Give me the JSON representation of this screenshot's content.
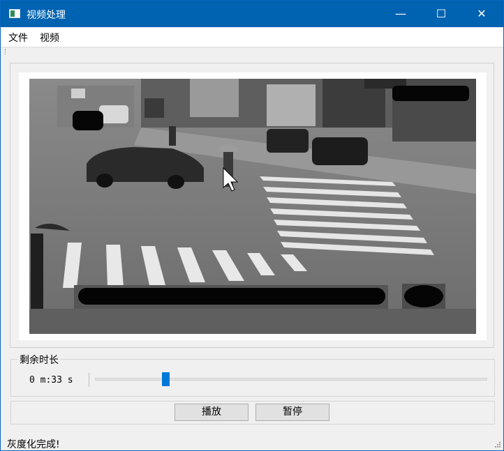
{
  "window": {
    "title": "视频处理",
    "minimize_glyph": "—",
    "maximize_glyph": "☐",
    "close_glyph": "✕",
    "icon": "app-window-icon"
  },
  "menubar": {
    "items": [
      {
        "label": "文件"
      },
      {
        "label": "视频"
      }
    ]
  },
  "video": {
    "content": "grayscale street crossing frame",
    "is_grayscale": true
  },
  "progress": {
    "group_title": "剩余时长",
    "remaining_text": "0 m:33 s",
    "slider_fraction": 0.18
  },
  "controls": {
    "play_label": "播放",
    "pause_label": "暂停"
  },
  "status": {
    "message": "灰度化完成!"
  },
  "colors": {
    "titlebar": "#0063b1",
    "accent": "#0078d7"
  }
}
